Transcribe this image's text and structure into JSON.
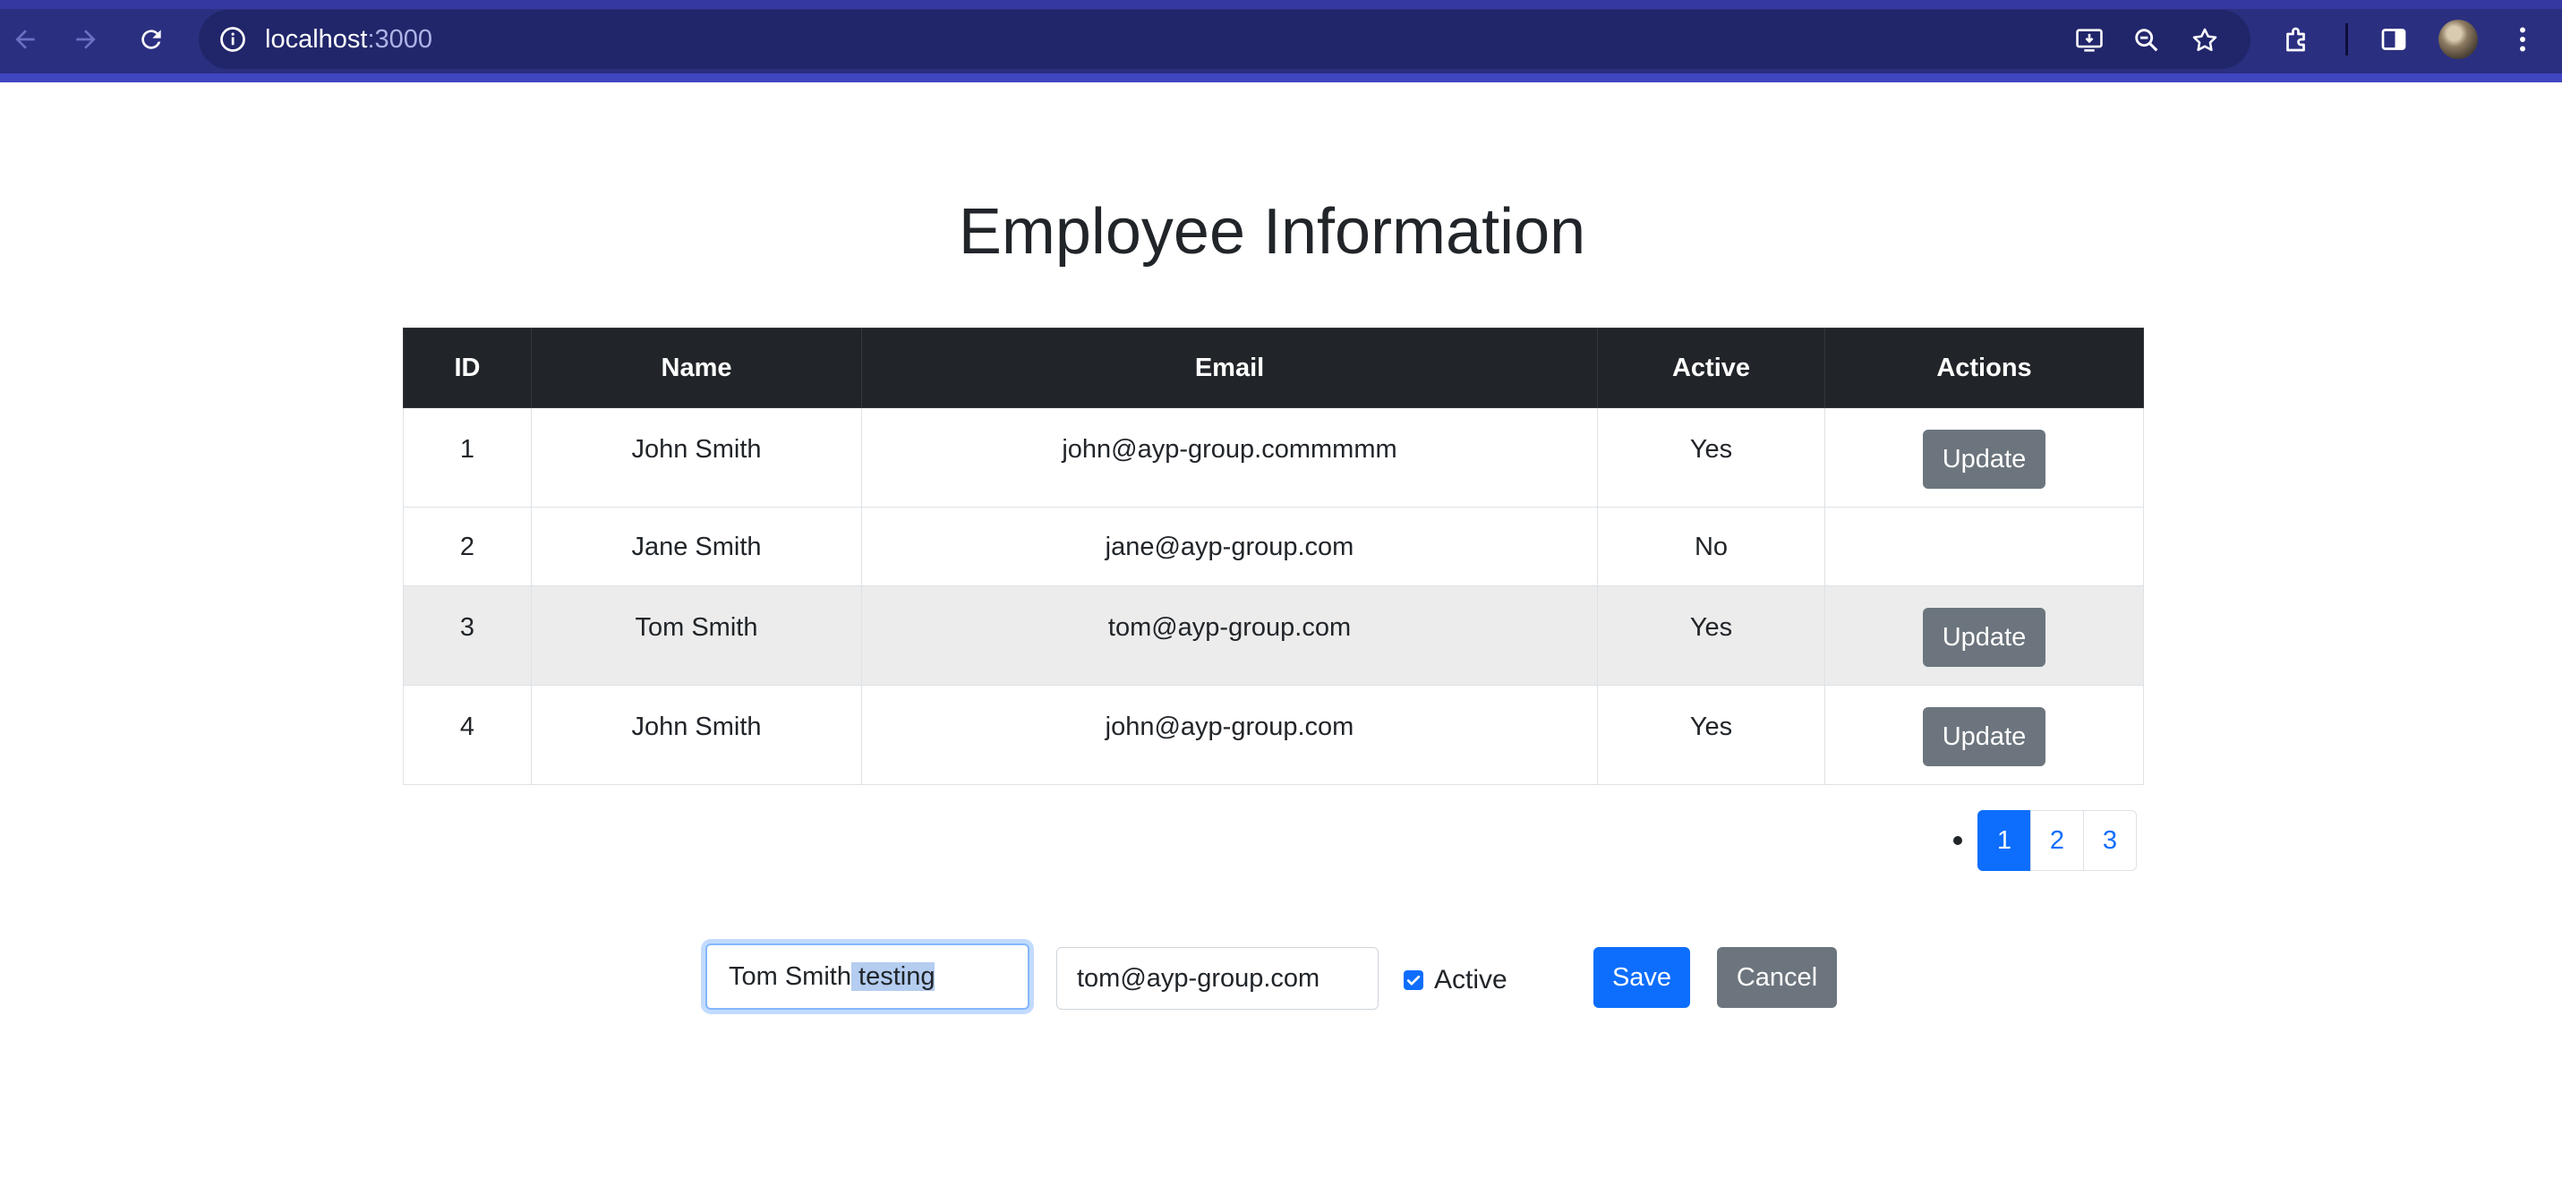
{
  "browser": {
    "url_host": "localhost",
    "url_port": ":3000"
  },
  "page": {
    "title": "Employee Information"
  },
  "table": {
    "headers": [
      "ID",
      "Name",
      "Email",
      "Active",
      "Actions"
    ],
    "rows": [
      {
        "id": "1",
        "name": "John Smith",
        "email": "john@ayp-group.commmmm",
        "active": "Yes",
        "action": "Update"
      },
      {
        "id": "2",
        "name": "Jane Smith",
        "email": "jane@ayp-group.com",
        "active": "No",
        "action": ""
      },
      {
        "id": "3",
        "name": "Tom Smith",
        "email": "tom@ayp-group.com",
        "active": "Yes",
        "action": "Update"
      },
      {
        "id": "4",
        "name": "John Smith",
        "email": "john@ayp-group.com",
        "active": "Yes",
        "action": "Update"
      }
    ]
  },
  "pagination": {
    "pages": [
      "1",
      "2",
      "3"
    ],
    "current": "1"
  },
  "edit_form": {
    "name_value_plain": "Tom Smith",
    "name_value_selected": " testing",
    "email_value": "tom@ayp-group.com",
    "active_checked": true,
    "active_label": "Active",
    "save_label": "Save",
    "cancel_label": "Cancel"
  },
  "colors": {
    "primary": "#0d6efd",
    "secondary": "#6c757d",
    "table_header": "#212529",
    "chrome": "#2b2f80"
  }
}
